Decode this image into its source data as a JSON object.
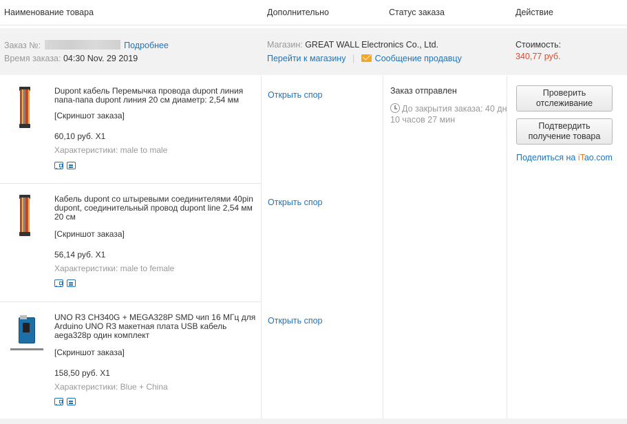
{
  "header": {
    "col_product": "Наименование товара",
    "col_extra": "Дополнительно",
    "col_status": "Статус заказа",
    "col_action": "Действие"
  },
  "order": {
    "number_label": "Заказ №:",
    "details_link": "Подробнее",
    "time_label": "Время заказа:",
    "time_value": "04:30 Nov. 29 2019",
    "store_label": "Магазин:",
    "store_name": "GREAT WALL Electronics Co., Ltd.",
    "go_to_store": "Перейти к магазину",
    "separator": "|",
    "message_seller": "Сообщение продавцу",
    "cost_label": "Стоимость:",
    "cost_value": "340,77 руб."
  },
  "items": [
    {
      "title": "Dupont кабель Перемычка провода dupont линия папа-папа dupont линия 20 см диаметр: 2,54 мм",
      "snapshot": "[Скриншот заказа]",
      "price": "60,10 руб. X1",
      "characteristics": "Характеристики: male to male",
      "dispute": "Открыть спор",
      "icons": [
        "truck-icon",
        "return-icon"
      ]
    },
    {
      "title": "Кабель dupont со штыревыми соединителями 40pin dupont, соединительный провод dupont line 2,54 мм 20 см",
      "snapshot": "[Скриншот заказа]",
      "price": "56,14 руб. X1",
      "characteristics": "Характеристики: male to female",
      "dispute": "Открыть спор",
      "icons": [
        "truck-icon",
        "return-icon"
      ]
    },
    {
      "title": "UNO R3 CH340G + MEGA328P SMD чип 16 МГц для Arduino UNO R3 макетная плата USB кабель aega328p один комплект",
      "snapshot": "[Скриншот заказа]",
      "price": "158,50 руб. X1",
      "characteristics": "Характеристики: Blue + China",
      "dispute": "Открыть спор",
      "icons": [
        "truck-icon",
        "return-icon"
      ]
    }
  ],
  "status": {
    "title": "Заказ отправлен",
    "timer_text": "До закрытия заказа: 40 дн 10 часов 27 мин"
  },
  "actions": {
    "track_button": "Проверить отслеживание",
    "confirm_button": "Подтвердить получение товара",
    "share_prefix": "Поделиться на ",
    "share_i": "iT",
    "share_rest": "ao.com"
  },
  "colors": {
    "link": "#2073b8",
    "price": "#e24a2b",
    "panel_bg": "#f2f2f2",
    "muted": "#999999"
  }
}
